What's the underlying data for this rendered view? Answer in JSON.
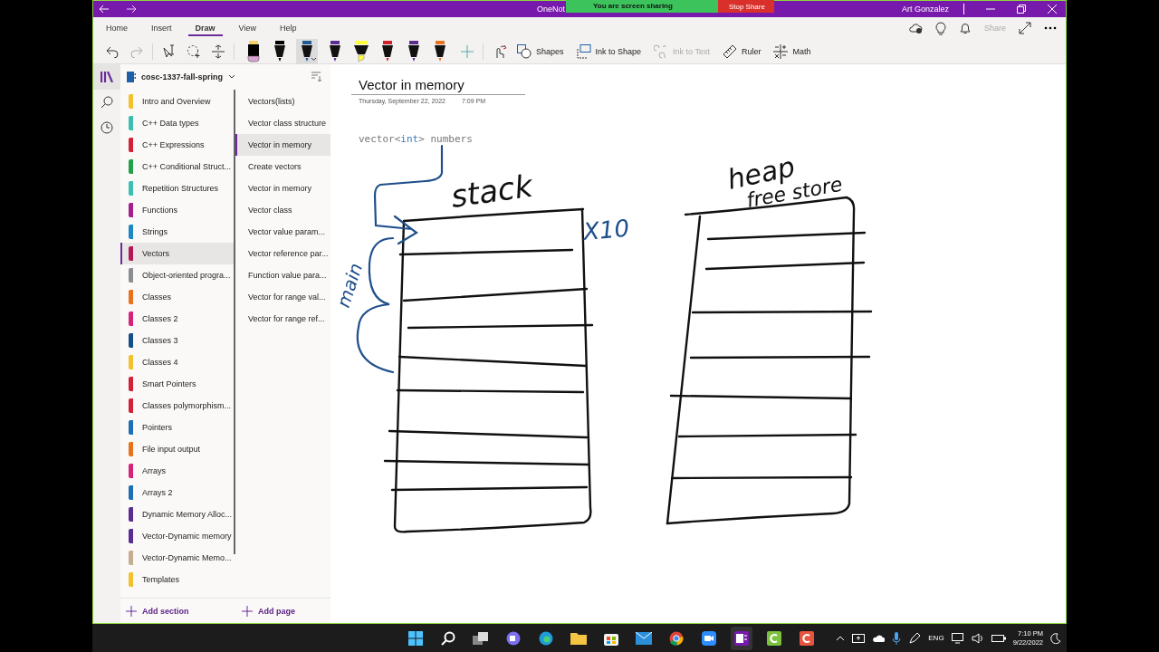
{
  "window": {
    "title": "OneNot",
    "user": "Art Gonzalez"
  },
  "sharing": {
    "status": "You are screen sharing",
    "stop": "Stop Share"
  },
  "ribbon_tabs": [
    {
      "label": "Home",
      "selected": false
    },
    {
      "label": "Insert",
      "selected": false
    },
    {
      "label": "Draw",
      "selected": true
    },
    {
      "label": "View",
      "selected": false
    },
    {
      "label": "Help",
      "selected": false
    }
  ],
  "share_button": {
    "label": "Share",
    "disabled": true
  },
  "pens": [
    {
      "kind": "eraser",
      "color": "#000000",
      "selected": false
    },
    {
      "kind": "pen",
      "color": "#000000",
      "selected": false
    },
    {
      "kind": "pen",
      "color": "#1e5a96",
      "selected": true
    },
    {
      "kind": "pen",
      "color": "#5b2d91",
      "selected": false
    },
    {
      "kind": "highlighter",
      "color": "#ffff3c",
      "selected": false
    },
    {
      "kind": "pen",
      "color": "#d0202e",
      "selected": false
    },
    {
      "kind": "pen",
      "color": "#5b2d91",
      "selected": false
    },
    {
      "kind": "pen",
      "color": "#e8731f",
      "selected": false
    }
  ],
  "draw_tools": [
    {
      "label": "Shapes",
      "disabled": false
    },
    {
      "label": "Ink to Shape",
      "disabled": false
    },
    {
      "label": "Ink to Text",
      "disabled": true
    },
    {
      "label": "Ruler",
      "disabled": false
    },
    {
      "label": "Math",
      "disabled": false
    }
  ],
  "notebook": {
    "name": "cosc-1337-fall-spring"
  },
  "sections": [
    {
      "label": "Intro and Overview",
      "color": "#f2c12e",
      "selected": false
    },
    {
      "label": "C++ Data types",
      "color": "#3bbfb0",
      "selected": false
    },
    {
      "label": "C++ Expressions",
      "color": "#d32238",
      "selected": false
    },
    {
      "label": "C++ Conditional Struct...",
      "color": "#24a148",
      "selected": false
    },
    {
      "label": "Repetition Structures",
      "color": "#3bbfb0",
      "selected": false
    },
    {
      "label": "Functions",
      "color": "#a3218f",
      "selected": false
    },
    {
      "label": "Strings",
      "color": "#1f88c4",
      "selected": false
    },
    {
      "label": "Vectors",
      "color": "#b4185a",
      "selected": true
    },
    {
      "label": "Object-oriented progra...",
      "color": "#8a8d91",
      "selected": false
    },
    {
      "label": "Classes",
      "color": "#e8731f",
      "selected": false
    },
    {
      "label": "Classes 2",
      "color": "#d6237a",
      "selected": false
    },
    {
      "label": "Classes 3",
      "color": "#164f85",
      "selected": false
    },
    {
      "label": "Classes 4",
      "color": "#f2c12e",
      "selected": false
    },
    {
      "label": "Smart Pointers",
      "color": "#d32238",
      "selected": false
    },
    {
      "label": "Classes polymorphism...",
      "color": "#d32238",
      "selected": false
    },
    {
      "label": "Pointers",
      "color": "#1f6fb4",
      "selected": false
    },
    {
      "label": "File input output",
      "color": "#e8731f",
      "selected": false
    },
    {
      "label": "Arrays",
      "color": "#d6237a",
      "selected": false
    },
    {
      "label": "Arrays 2",
      "color": "#1f6fb4",
      "selected": false
    },
    {
      "label": "Dynamic Memory Alloc...",
      "color": "#5a2d91",
      "selected": false
    },
    {
      "label": "Vector-Dynamic memory",
      "color": "#5a2d91",
      "selected": false
    },
    {
      "label": "Vector-Dynamic Memo...",
      "color": "#c4ae8f",
      "selected": false
    },
    {
      "label": "Templates",
      "color": "#f2c12e",
      "selected": false
    }
  ],
  "pages": [
    {
      "label": "Vectors(lists)",
      "selected": false
    },
    {
      "label": "Vector class structure",
      "selected": false
    },
    {
      "label": "Vector in memory",
      "selected": true
    },
    {
      "label": "Create vectors",
      "selected": false
    },
    {
      "label": "Vector in memory",
      "selected": false
    },
    {
      "label": "Vector class",
      "selected": false
    },
    {
      "label": "Vector value param...",
      "selected": false
    },
    {
      "label": "Vector reference par...",
      "selected": false
    },
    {
      "label": "Function value para...",
      "selected": false
    },
    {
      "label": "Vector for range  val...",
      "selected": false
    },
    {
      "label": "Vector for range ref...",
      "selected": false
    }
  ],
  "add_section": "Add section",
  "add_page": "Add page",
  "note": {
    "title": "Vector in memory",
    "date": "Thursday, September 22, 2022",
    "time": "7:09 PM",
    "code": [
      {
        "text": "vector<",
        "kind": "plain"
      },
      {
        "text": "int",
        "kind": "keyword"
      },
      {
        "text": ">",
        "kind": "plain"
      },
      {
        "text": " numbers",
        "kind": "plain"
      }
    ]
  },
  "ink_labels": [
    {
      "text": "stack",
      "kind": "stack"
    },
    {
      "text": "X10",
      "kind": "count"
    },
    {
      "text": "heap",
      "kind": "heap"
    },
    {
      "text": "free store",
      "kind": "store"
    },
    {
      "text": "main",
      "kind": "main"
    }
  ],
  "taskbar": {
    "language": "ENG",
    "time": "7:10 PM",
    "date": "9/22/2022"
  }
}
